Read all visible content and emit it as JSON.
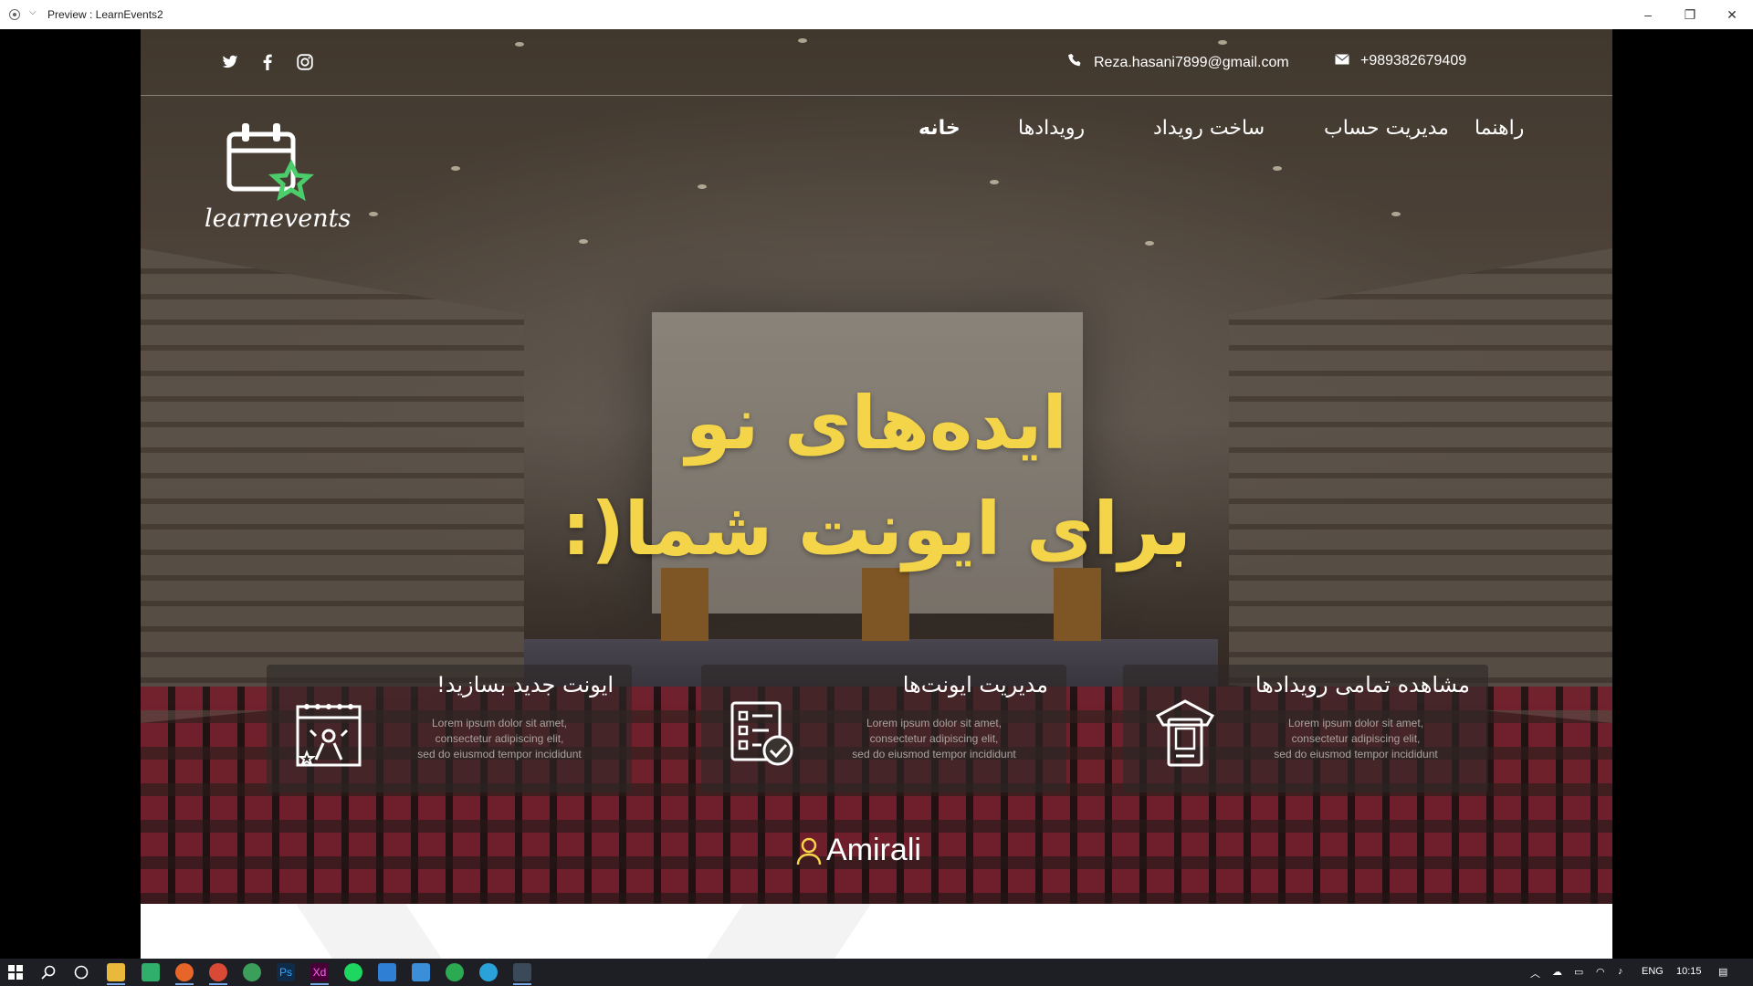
{
  "window": {
    "title": "Preview : LearnEvents2",
    "controls": {
      "minimize": "–",
      "restore": "❐",
      "close": "✕"
    }
  },
  "topbar": {
    "socials": [
      "twitter-icon",
      "facebook-icon",
      "instagram-icon"
    ],
    "email": "Reza.hasani7899@gmail.com",
    "phone": "+989382679409"
  },
  "nav": {
    "logo_text": "learnevents",
    "items": [
      "راهنما",
      "مدیریت حساب",
      "ساخت رویداد",
      "رویدادها",
      "خانه"
    ],
    "active": "خانه"
  },
  "hero": {
    "line1": "ایده‌های نو",
    "line2": "برای ایونت شما(:",
    "accent_color": "#f4d54a"
  },
  "cards": [
    {
      "title": "ایونت جدید بسازید!",
      "desc1": "Lorem ipsum dolor sit amet,",
      "desc2": "consectetur adipiscing elit,",
      "desc3": "sed do eiusmod tempor incididunt",
      "icon": "party-calendar-icon"
    },
    {
      "title": "مدیریت ایونت‌ها",
      "desc1": "Lorem ipsum dolor sit amet,",
      "desc2": "consectetur adipiscing elit,",
      "desc3": "sed do eiusmod tempor incididunt",
      "icon": "checklist-icon"
    },
    {
      "title": "مشاهده تمامی رویدادها",
      "desc1": "Lorem ipsum dolor sit amet,",
      "desc2": "consectetur adipiscing elit,",
      "desc3": "sed do eiusmod tempor incididunt",
      "icon": "ticket-icon"
    }
  ],
  "user": {
    "name": "Amirali"
  },
  "taskbar": {
    "apps": [
      "start-icon",
      "search-icon",
      "cortana-icon",
      "file-explorer-icon",
      "app-green-icon",
      "firefox-icon",
      "chrome-icon",
      "edge-icon",
      "photoshop-icon",
      "xd-icon",
      "spotify-icon",
      "vscode-icon",
      "app-blue-icon",
      "app-green2-icon",
      "telegram-icon",
      "terminal-icon"
    ],
    "lang": "ENG",
    "time": "10:15"
  }
}
